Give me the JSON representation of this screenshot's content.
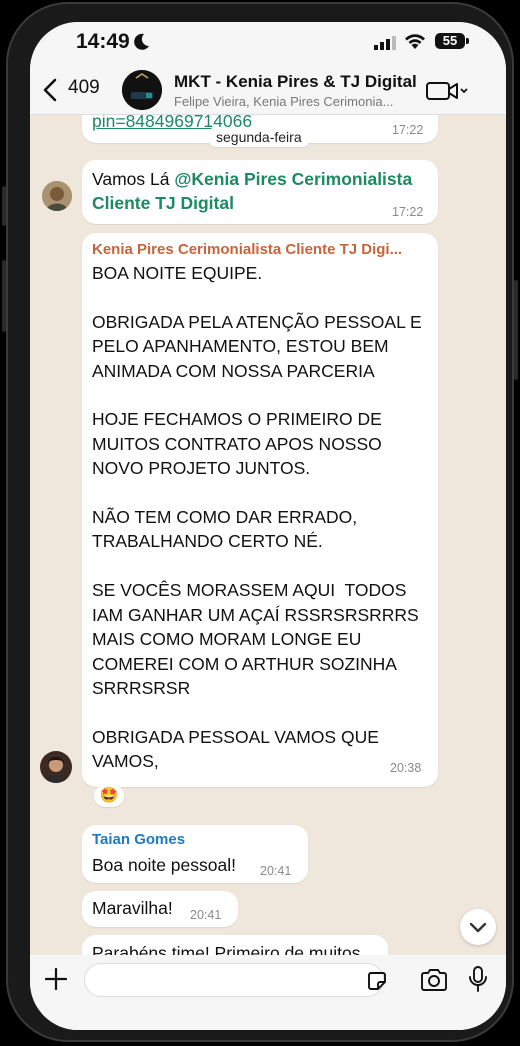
{
  "status_bar": {
    "time": "14:49",
    "battery": "55"
  },
  "header": {
    "back_count": "409",
    "title": "MKT - Kenia Pires & TJ Digital",
    "subtitle": "Felipe Vieira, Kenia Pires Cerimonia..."
  },
  "chat": {
    "day_divider": "segunda-feira",
    "messages": [
      {
        "link": "pin=8484969714066",
        "time": "17:22"
      },
      {
        "text_prefix": "Vamos Lá ",
        "mention_line1": "@Kenia Pires Cerimonialista",
        "mention_line2": "Cliente TJ Digital",
        "time": "17:22"
      },
      {
        "sender": "Kenia Pires Cerimonialista Cliente TJ Digi...",
        "text": "BOA NOITE EQUIPE.\n\nOBRIGADA PELA ATENÇÃO PESSOAL E\nPELO APANHAMENTO, ESTOU BEM\nANIMADA COM NOSSA PARCERIA\n\nHOJE FECHAMOS O PRIMEIRO DE\nMUITOS CONTRATO APOS NOSSO\nNOVO PROJETO JUNTOS.\n\nNÃO TEM COMO DAR ERRADO,\nTRABALHANDO CERTO NÉ.\n\nSE VOCÊS MORASSEM AQUI  TODOS\nIAM GANHAR UM AÇAÍ RSSRSRSRRRS\nMAIS COMO MORAM LONGE EU\nCOMEREI COM O ARTHUR SOZINHA\nSRRRSRSR\n\nOBRIGADA PESSOAL VAMOS QUE\nVAMOS,",
        "time": "20:38",
        "reaction": "🤩"
      },
      {
        "sender": "Taian Gomes",
        "text": "Boa noite pessoal!",
        "time": "20:41"
      },
      {
        "text": "Maravilha!",
        "time": "20:41"
      },
      {
        "text": "Parabéns time! Primeiro de muitos"
      }
    ]
  },
  "colors": {
    "mention": "#1d8a63",
    "sender_kenia": "#c7643a",
    "sender_taian": "#1f7ac4",
    "chat_bg": "#efe7dc"
  },
  "icons": [
    "moon-icon",
    "signal-icon",
    "wifi-icon",
    "back-chevron-icon",
    "video-call-icon",
    "plus-icon",
    "sticker-icon",
    "camera-icon",
    "mic-icon",
    "chevron-down-icon"
  ]
}
